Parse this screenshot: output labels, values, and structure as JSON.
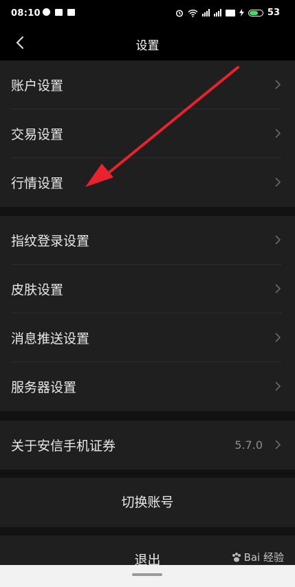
{
  "status_bar": {
    "time": "08:10",
    "battery_level": "53"
  },
  "header": {
    "title": "设置"
  },
  "groups": {
    "g1": [
      "账户设置",
      "交易设置",
      "行情设置"
    ],
    "g2": [
      "指纹登录设置",
      "皮肤设置",
      "消息推送设置",
      "服务器设置"
    ],
    "g3": {
      "label": "关于安信手机证券",
      "version": "5.7.0"
    }
  },
  "actions": {
    "switch_account": "切换账号",
    "logout": "退出"
  },
  "watermark": "Bai 经验",
  "colors": {
    "background": "#121212",
    "card": "#1f1f1f",
    "arrow": "#e8232d",
    "battery": "#4cd964"
  }
}
